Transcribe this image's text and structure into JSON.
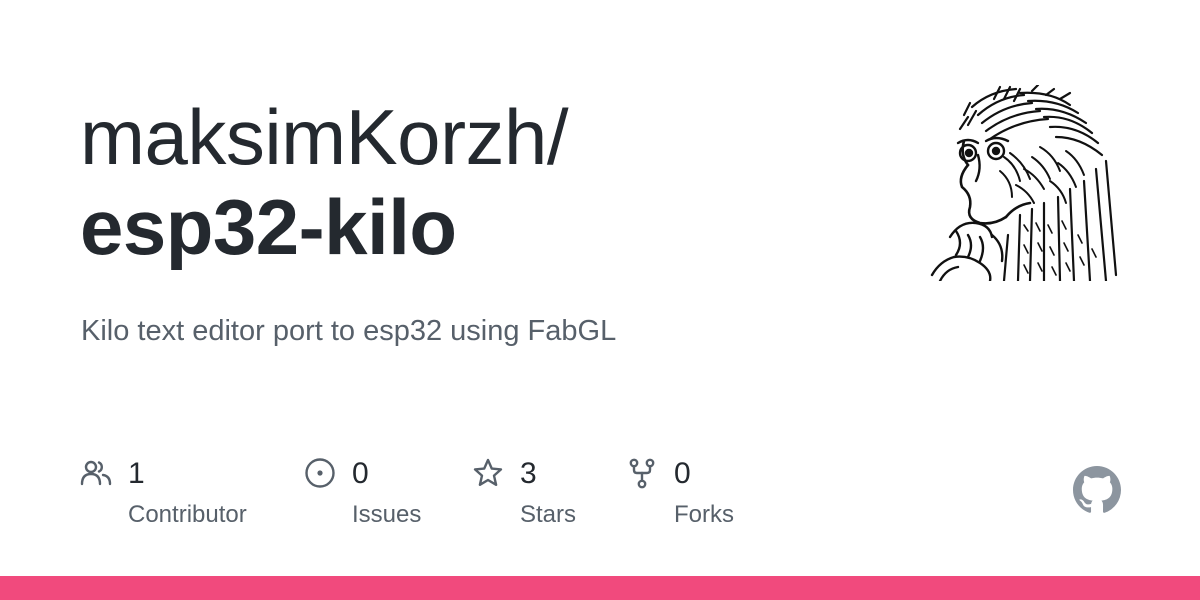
{
  "header": {
    "owner": "maksimKorzh/",
    "repo": "esp32-kilo"
  },
  "description": "Kilo text editor port to esp32 using FabGL",
  "stats": [
    {
      "icon": "people-icon",
      "count": "1",
      "label": "Contributor"
    },
    {
      "icon": "issue-opened-icon",
      "count": "0",
      "label": "Issues"
    },
    {
      "icon": "star-icon",
      "count": "3",
      "label": "Stars"
    },
    {
      "icon": "repo-forked-icon",
      "count": "0",
      "label": "Forks"
    }
  ],
  "avatar": {
    "icon": "owner-avatar"
  },
  "logo": {
    "icon": "github-mark-icon"
  },
  "colors": {
    "text_primary": "#24292f",
    "text_secondary": "#57606a",
    "icon_gray": "#57606a",
    "logo_gray": "#8c959f",
    "accent_bar": "#f14a7d"
  }
}
